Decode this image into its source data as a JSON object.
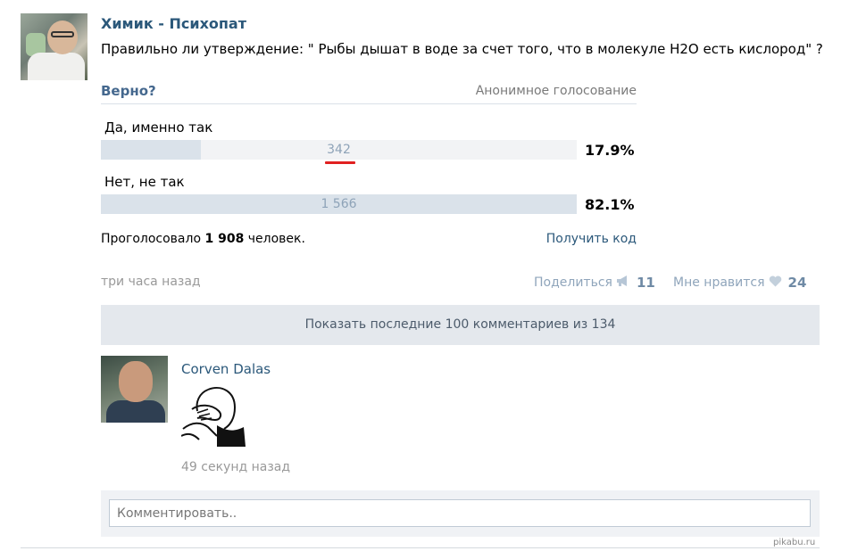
{
  "post": {
    "author": "Химик - Психопат",
    "text": "Правильно ли утверждение: \" Рыбы дышат в воде за счет того, что в молекуле H2O есть кислород\" ?"
  },
  "poll": {
    "title": "Верно?",
    "type": "Анонимное голосование",
    "options": [
      {
        "label": "Да, именно так",
        "count": "342",
        "percent": "17.9%",
        "fraction": 0.21
      },
      {
        "label": "Нет, не так",
        "count": "1 566",
        "percent": "82.1%",
        "fraction": 1.0
      }
    ],
    "voted_prefix": "Проголосовало",
    "voted_count": "1 908",
    "voted_suffix": "человек.",
    "get_code": "Получить код"
  },
  "meta": {
    "time": "три часа назад",
    "share_label": "Поделиться",
    "share_count": "11",
    "like_label": "Мне нравится",
    "like_count": "24"
  },
  "comments": {
    "show_label": "Показать последние 100 комментариев из 134",
    "items": [
      {
        "author": "Corven Dalas",
        "time": "49 секунд назад"
      }
    ],
    "input_placeholder": "Комментировать.."
  },
  "watermark": "pikabu.ru",
  "colors": {
    "link": "#2b587a",
    "bar_fill": "#dae2ea",
    "bar_track": "#f2f3f5",
    "highlight": "#e02020"
  }
}
